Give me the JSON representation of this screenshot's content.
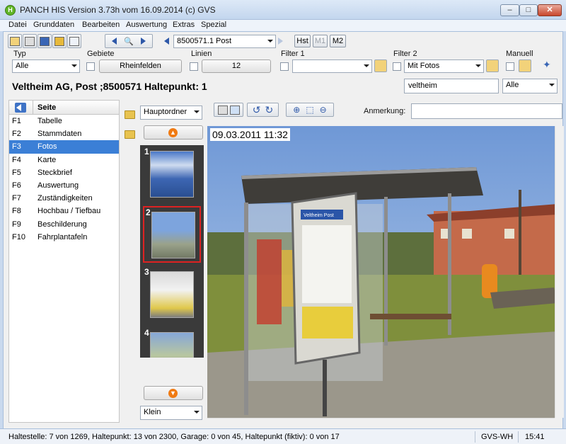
{
  "window": {
    "title": "PANCH HIS Version 3.73h vom 16.09.2014 (c) GVS",
    "app_icon_letter": "H",
    "min_glyph": "–",
    "max_glyph": "□",
    "close_glyph": "✕"
  },
  "menu": [
    "Datei",
    "Grunddaten",
    "Bearbeiten",
    "Auswertung",
    "Extras",
    "Spezial"
  ],
  "toolbar": {
    "location_select": "8500571.1 Post",
    "btn_hst": "Hst",
    "btn_m1": "M1",
    "btn_m2": "M2"
  },
  "filters": {
    "typ_label": "Typ",
    "typ_value": "Alle",
    "gebiete_label": "Gebiete",
    "gebiete_value": "Rheinfelden",
    "linien_label": "Linien",
    "linien_value": "12",
    "filter1_label": "Filter 1",
    "filter1_value": "",
    "filter2_label": "Filter 2",
    "filter2_value": "Mit Fotos",
    "manuell_label": "Manuell"
  },
  "heading": "Veltheim AG, Post ;8500571 Haltepunkt: 1",
  "search": {
    "value": "veltheim",
    "scope": "Alle"
  },
  "nav": {
    "title": "Seite",
    "items": [
      {
        "key": "F1",
        "label": "Tabelle"
      },
      {
        "key": "F2",
        "label": "Stammdaten"
      },
      {
        "key": "F3",
        "label": "Fotos"
      },
      {
        "key": "F4",
        "label": "Karte"
      },
      {
        "key": "F5",
        "label": "Steckbrief"
      },
      {
        "key": "F6",
        "label": "Auswertung"
      },
      {
        "key": "F7",
        "label": "Zuständigkeiten"
      },
      {
        "key": "F8",
        "label": "Hochbau / Tiefbau"
      },
      {
        "key": "F9",
        "label": "Beschilderung"
      },
      {
        "key": "F10",
        "label": "Fahrplantafeln"
      }
    ],
    "selected_index": 2
  },
  "photos": {
    "folder": "Hauptordner",
    "size": "Klein",
    "anmerkung_label": "Anmerkung:",
    "anmerkung_value": "",
    "timestamp": "09.03.2011 11:32",
    "thumbnails": [
      "1",
      "2",
      "3",
      "4"
    ],
    "selected_thumb": 1,
    "sign_text": "Veltheim Post"
  },
  "status": {
    "counts": "Haltestelle: 7 von 1269, Haltepunkt: 13 von 2300, Garage: 0 von 45, Haltepunkt (fiktiv): 0 von 17",
    "user": "GVS-WH",
    "time": "15:41"
  },
  "colors": {
    "selection": "#3b7fd6",
    "accent_orange": "#f07a12",
    "selected_thumb_border": "#dd2222"
  }
}
